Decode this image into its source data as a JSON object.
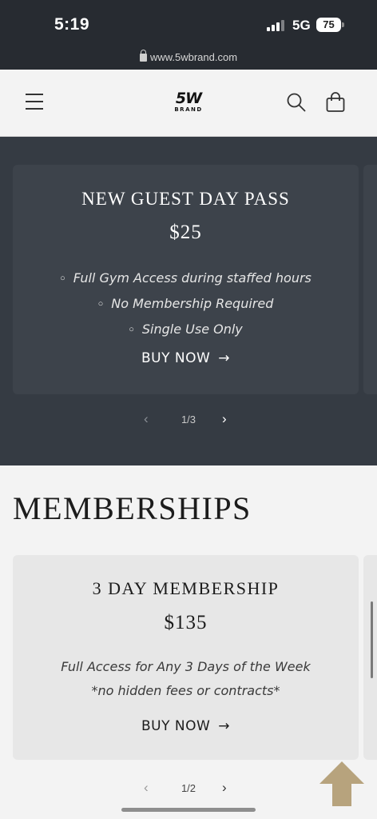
{
  "status_bar": {
    "time": "5:19",
    "network": "5G",
    "battery": "75"
  },
  "browser": {
    "url": "www.5wbrand.com"
  },
  "header": {
    "logo_main": "5W",
    "logo_sub": "BRAND"
  },
  "day_pass": {
    "title": "NEW GUEST DAY PASS",
    "price": "$25",
    "features": [
      "Full Gym Access during staffed hours",
      "No Membership Required",
      "Single Use Only"
    ],
    "buy_label": "BUY NOW",
    "pager": "1/3"
  },
  "memberships": {
    "heading": "MEMBERSHIPS",
    "card": {
      "title": "3 DAY MEMBERSHIP",
      "price": "$135",
      "desc_line1": "Full Access for Any 3 Days of the Week",
      "desc_line2": "*no hidden fees or contracts*",
      "buy_label": "BUY NOW"
    },
    "pager": "1/2"
  },
  "colors": {
    "dark_section": "#353b43",
    "dark_card": "#3d434b",
    "light_card": "#e7e7e7",
    "back_to_top": "#b7a37d"
  },
  "icons": [
    "lock-icon",
    "menu-icon",
    "search-icon",
    "cart-icon",
    "arrow-right-icon",
    "chevron-left-icon",
    "chevron-right-icon",
    "arrow-up-icon"
  ]
}
